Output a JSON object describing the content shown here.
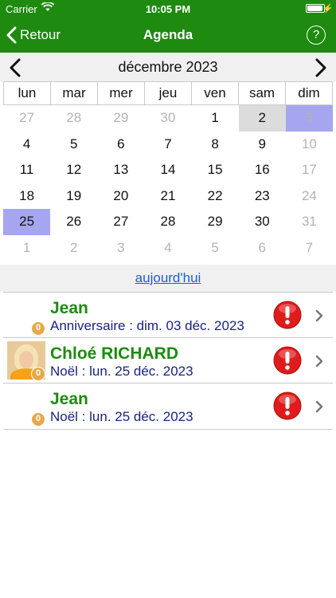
{
  "status_bar": {
    "carrier": "Carrier",
    "time": "10:05 PM",
    "battery_level": 0.95
  },
  "nav": {
    "back_label": "Retour",
    "title": "Agenda",
    "help_label": "?"
  },
  "calendar": {
    "month_label": "décembre 2023",
    "weekdays": [
      "lun",
      "mar",
      "mer",
      "jeu",
      "ven",
      "sam",
      "dim"
    ],
    "weeks": [
      [
        "27",
        "28",
        "29",
        "30",
        "1",
        "2",
        "3"
      ],
      [
        "4",
        "5",
        "6",
        "7",
        "8",
        "9",
        "10"
      ],
      [
        "11",
        "12",
        "13",
        "14",
        "15",
        "16",
        "17"
      ],
      [
        "18",
        "19",
        "20",
        "21",
        "22",
        "23",
        "24"
      ],
      [
        "25",
        "26",
        "27",
        "28",
        "29",
        "30",
        "31"
      ],
      [
        "1",
        "2",
        "3",
        "4",
        "5",
        "6",
        "7"
      ]
    ]
  },
  "today_link": "aujourd'hui",
  "events": [
    {
      "name": "Jean",
      "detail": "Anniversaire : dim. 03 déc. 2023",
      "badge": "0",
      "has_photo": false
    },
    {
      "name": "Chloé RICHARD",
      "detail": "Noël : lun. 25 déc. 2023",
      "badge": "0",
      "has_photo": true
    },
    {
      "name": "Jean",
      "detail": "Noël : lun. 25 déc. 2023",
      "badge": "0",
      "has_photo": false
    }
  ],
  "colors": {
    "header_green": "#1e8a10",
    "selected_blue": "#a6a6f0",
    "today_gray": "#dcdcdc",
    "alert_red": "#e01b1b",
    "name_green": "#1e8a10",
    "detail_navy": "#1a237e"
  },
  "icons": {
    "back": "chevron-left-icon",
    "help": "question-circle-icon",
    "prev": "chevron-left-icon",
    "next": "chevron-right-icon",
    "alert": "exclamation-circle-icon",
    "row": "chevron-right-icon"
  }
}
